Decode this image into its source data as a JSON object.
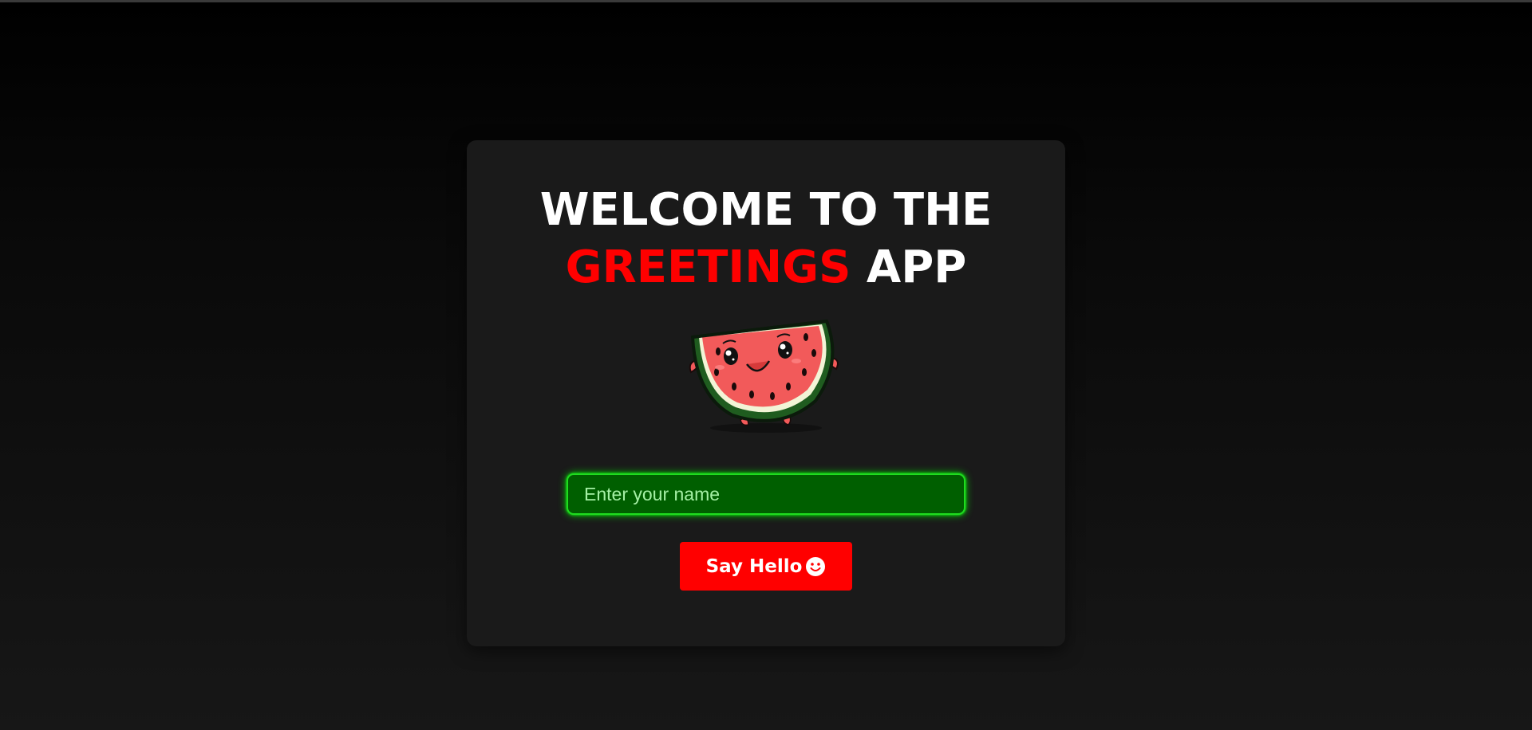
{
  "header": {
    "title_line1": "WELCOME TO THE",
    "title_accent": "GREETINGS",
    "title_end": "APP"
  },
  "mascot": {
    "icon": "watermelon-slice-icon"
  },
  "form": {
    "name_placeholder": "Enter your name",
    "name_value": ""
  },
  "button": {
    "label": "Say Hello",
    "icon": "smiley-icon"
  },
  "colors": {
    "background_top": "#000000",
    "card": "#1a1a1a",
    "accent_red": "#ff0000",
    "input_bg": "#005f00",
    "input_glow": "#1fdc1f"
  }
}
